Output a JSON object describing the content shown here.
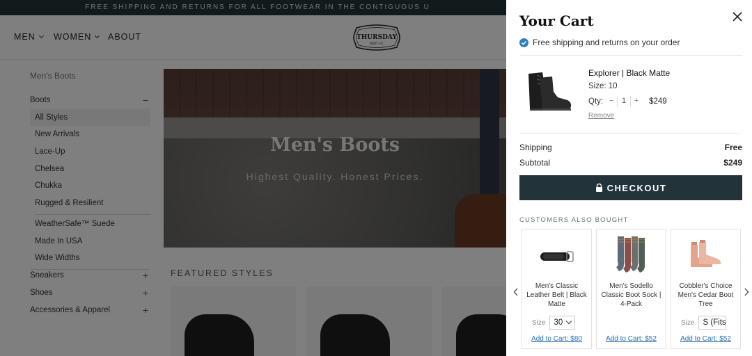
{
  "banner": {
    "text": "FREE SHIPPING AND RETURNS FOR ALL FOOTWEAR IN THE CONTIGUOUS U"
  },
  "nav": {
    "items": [
      {
        "label": "MEN",
        "dropdown": true
      },
      {
        "label": "WOMEN",
        "dropdown": true
      },
      {
        "label": "ABOUT",
        "dropdown": false
      }
    ],
    "logo_text": "THURSDAY BOOT CO."
  },
  "sidebar": {
    "breadcrumb": "Men's Boots",
    "boots": {
      "label": "Boots",
      "sign": "−"
    },
    "sub_items": [
      "All Styles",
      "New Arrivals",
      "Lace-Up",
      "Chelsea",
      "Chukka",
      "Rugged & Resilient"
    ],
    "sub_items_2": [
      "WeatherSafe™ Suede",
      "Made In USA",
      "Wide Widths"
    ],
    "other": [
      {
        "label": "Sneakers",
        "sign": "+"
      },
      {
        "label": "Shoes",
        "sign": "+"
      },
      {
        "label": "Accessories & Apparel",
        "sign": "+"
      }
    ]
  },
  "hero": {
    "title": "Men's Boots",
    "subtitle": "Highest Quality. Honest Prices."
  },
  "featured": {
    "heading": "FEATURED STYLES"
  },
  "cart": {
    "title": "Your Cart",
    "shipping_note": "Free shipping and returns on your order",
    "item": {
      "name": "Explorer | Black Matte",
      "size_label": "Size:",
      "size_value": "10",
      "qty_label": "Qty:",
      "qty_minus": "−",
      "qty": "1",
      "qty_plus": "+",
      "price": "$249",
      "remove": "Remove"
    },
    "shipping_label": "Shipping",
    "shipping_value": "Free",
    "subtotal_label": "Subtotal",
    "subtotal_value": "$249",
    "checkout_label": "CHECKOUT",
    "also_bought_heading": "CUSTOMERS ALSO BOUGHT",
    "recommendations": [
      {
        "name": "Men's Classic Leather Belt | Black Matte",
        "option_label": "Size",
        "option_value": "30",
        "add_label": "Add to Cart: $80"
      },
      {
        "name": "Men's Sodello Classic Boot Sock | 4-Pack",
        "option_label": "",
        "option_value": "",
        "add_label": "Add to Cart: $52"
      },
      {
        "name": "Cobbler's Choice Men's Cedar Boot Tree",
        "option_label": "Size",
        "option_value": "S (Fits",
        "add_label": "Add to Cart: $52"
      }
    ]
  },
  "colors": {
    "brand_dark": "#22343a",
    "link_blue": "#2a6fb0",
    "check_blue": "#2f7fc1"
  }
}
